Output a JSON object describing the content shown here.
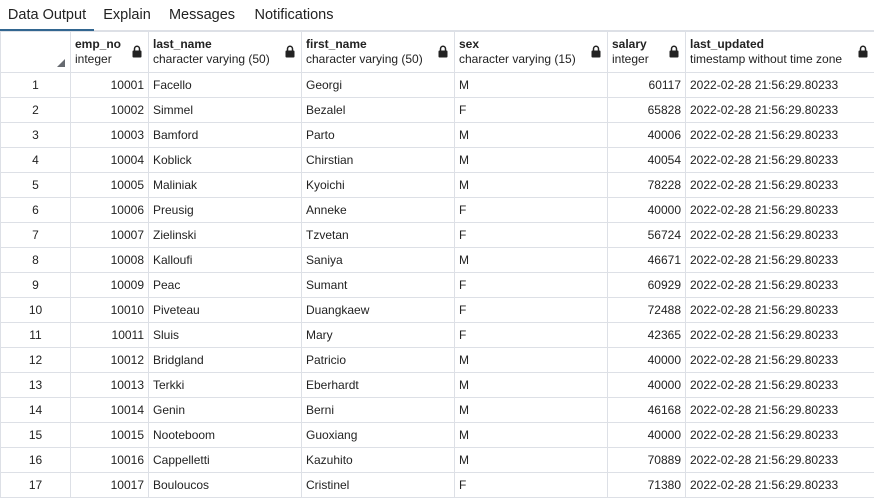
{
  "tabs": [
    {
      "label": "Data Output",
      "active": true
    },
    {
      "label": "Explain",
      "active": false
    },
    {
      "label": "Messages",
      "active": false
    },
    {
      "label": "Notifications",
      "active": false
    }
  ],
  "columns": [
    {
      "name": "emp_no",
      "type": "integer"
    },
    {
      "name": "last_name",
      "type": "character varying (50)"
    },
    {
      "name": "first_name",
      "type": "character varying (50)"
    },
    {
      "name": "sex",
      "type": "character varying (15)"
    },
    {
      "name": "salary",
      "type": "integer"
    },
    {
      "name": "last_updated",
      "type": "timestamp without time zone"
    }
  ],
  "rows": [
    [
      "1",
      "10001",
      "Facello",
      "Georgi",
      "M",
      "60117",
      "2022-02-28 21:56:29.80233"
    ],
    [
      "2",
      "10002",
      "Simmel",
      "Bezalel",
      "F",
      "65828",
      "2022-02-28 21:56:29.80233"
    ],
    [
      "3",
      "10003",
      "Bamford",
      "Parto",
      "M",
      "40006",
      "2022-02-28 21:56:29.80233"
    ],
    [
      "4",
      "10004",
      "Koblick",
      "Chirstian",
      "M",
      "40054",
      "2022-02-28 21:56:29.80233"
    ],
    [
      "5",
      "10005",
      "Maliniak",
      "Kyoichi",
      "M",
      "78228",
      "2022-02-28 21:56:29.80233"
    ],
    [
      "6",
      "10006",
      "Preusig",
      "Anneke",
      "F",
      "40000",
      "2022-02-28 21:56:29.80233"
    ],
    [
      "7",
      "10007",
      "Zielinski",
      "Tzvetan",
      "F",
      "56724",
      "2022-02-28 21:56:29.80233"
    ],
    [
      "8",
      "10008",
      "Kalloufi",
      "Saniya",
      "M",
      "46671",
      "2022-02-28 21:56:29.80233"
    ],
    [
      "9",
      "10009",
      "Peac",
      "Sumant",
      "F",
      "60929",
      "2022-02-28 21:56:29.80233"
    ],
    [
      "10",
      "10010",
      "Piveteau",
      "Duangkaew",
      "F",
      "72488",
      "2022-02-28 21:56:29.80233"
    ],
    [
      "11",
      "10011",
      "Sluis",
      "Mary",
      "F",
      "42365",
      "2022-02-28 21:56:29.80233"
    ],
    [
      "12",
      "10012",
      "Bridgland",
      "Patricio",
      "M",
      "40000",
      "2022-02-28 21:56:29.80233"
    ],
    [
      "13",
      "10013",
      "Terkki",
      "Eberhardt",
      "M",
      "40000",
      "2022-02-28 21:56:29.80233"
    ],
    [
      "14",
      "10014",
      "Genin",
      "Berni",
      "M",
      "46168",
      "2022-02-28 21:56:29.80233"
    ],
    [
      "15",
      "10015",
      "Nooteboom",
      "Guoxiang",
      "M",
      "40000",
      "2022-02-28 21:56:29.80233"
    ],
    [
      "16",
      "10016",
      "Cappelletti",
      "Kazuhito",
      "M",
      "70889",
      "2022-02-28 21:56:29.80233"
    ],
    [
      "17",
      "10017",
      "Bouloucos",
      "Cristinel",
      "F",
      "71380",
      "2022-02-28 21:56:29.80233"
    ]
  ],
  "colors": {
    "accent": "#326690",
    "grid_border": "#dde0e6",
    "text": "#222222"
  },
  "icons": {
    "column_lock": "lock-icon",
    "corner": "select-all-corner-icon"
  }
}
